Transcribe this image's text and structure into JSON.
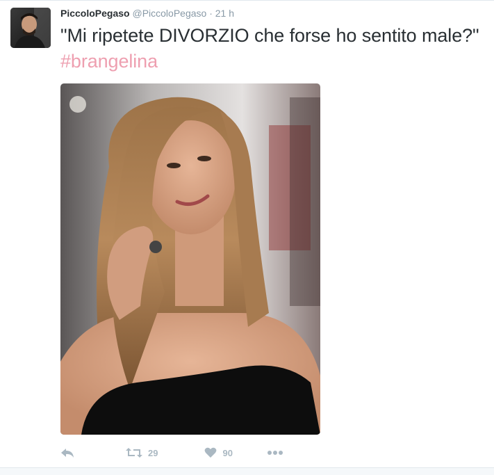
{
  "tweet": {
    "author": {
      "fullname": "PiccoloPegaso",
      "handle": "@PiccoloPegaso",
      "separator": "·",
      "time": "21 h"
    },
    "text": {
      "body": "\"Mi ripetete DIVORZIO che forse ho sentito male?\"",
      "hashtag": "#brangelina"
    },
    "media": {
      "description": "photo"
    },
    "actions": {
      "reply_icon": "reply-icon",
      "retweet_icon": "retweet-icon",
      "retweet_count": "29",
      "like_icon": "heart-icon",
      "like_count": "90",
      "more_icon": "more-icon"
    }
  },
  "colors": {
    "hashtag": "#ee9fb0",
    "muted": "#8899a6",
    "action": "#aab8c2",
    "text": "#292f33"
  }
}
